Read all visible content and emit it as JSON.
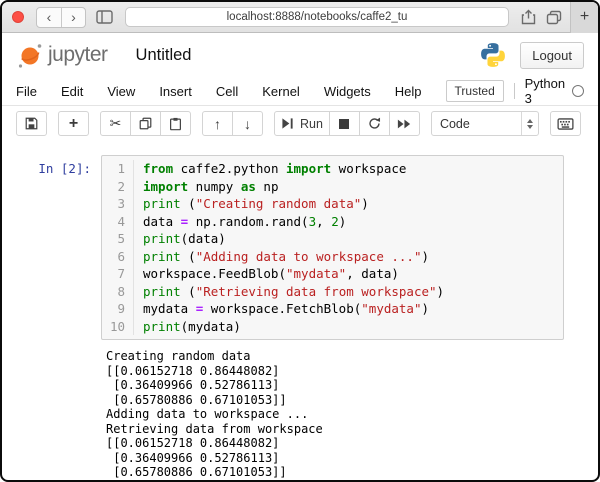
{
  "browser": {
    "url": "localhost:8888/notebooks/caffe2_tu",
    "back_label": "‹",
    "forward_label": "›",
    "new_tab_label": "+"
  },
  "header": {
    "brand": "jupyter",
    "title": "Untitled",
    "logout_label": "Logout"
  },
  "menu": {
    "items": [
      "File",
      "Edit",
      "View",
      "Insert",
      "Cell",
      "Kernel",
      "Widgets",
      "Help"
    ],
    "trusted_label": "Trusted",
    "kernel_name": "Python 3"
  },
  "toolbar": {
    "run_label": "Run",
    "cell_type_value": "Code",
    "icons": {
      "add": "+",
      "cut": "✂",
      "move_up": "↑",
      "move_down": "↓"
    }
  },
  "cell": {
    "prompt": "In [2]:",
    "lines": [
      {
        "n": 1,
        "tokens": [
          {
            "c": "kw",
            "t": "from"
          },
          {
            "c": "pl",
            "t": " caffe2.python "
          },
          {
            "c": "kw",
            "t": "import"
          },
          {
            "c": "pl",
            "t": " workspace"
          }
        ]
      },
      {
        "n": 2,
        "tokens": [
          {
            "c": "kw",
            "t": "import"
          },
          {
            "c": "pl",
            "t": " numpy "
          },
          {
            "c": "kw",
            "t": "as"
          },
          {
            "c": "pl",
            "t": " np"
          }
        ]
      },
      {
        "n": 3,
        "tokens": [
          {
            "c": "bi",
            "t": "print"
          },
          {
            "c": "pl",
            "t": " ("
          },
          {
            "c": "str",
            "t": "\"Creating random data\""
          },
          {
            "c": "pl",
            "t": ")"
          }
        ]
      },
      {
        "n": 4,
        "tokens": [
          {
            "c": "pl",
            "t": "data "
          },
          {
            "c": "op",
            "t": "="
          },
          {
            "c": "pl",
            "t": " np.random.rand("
          },
          {
            "c": "num",
            "t": "3"
          },
          {
            "c": "pl",
            "t": ", "
          },
          {
            "c": "num",
            "t": "2"
          },
          {
            "c": "pl",
            "t": ")"
          }
        ]
      },
      {
        "n": 5,
        "tokens": [
          {
            "c": "bi",
            "t": "print"
          },
          {
            "c": "pl",
            "t": "(data)"
          }
        ]
      },
      {
        "n": 6,
        "tokens": [
          {
            "c": "bi",
            "t": "print"
          },
          {
            "c": "pl",
            "t": " ("
          },
          {
            "c": "str",
            "t": "\"Adding data to workspace ...\""
          },
          {
            "c": "pl",
            "t": ")"
          }
        ]
      },
      {
        "n": 7,
        "tokens": [
          {
            "c": "pl",
            "t": "workspace.FeedBlob("
          },
          {
            "c": "str",
            "t": "\"mydata\""
          },
          {
            "c": "pl",
            "t": ", data)"
          }
        ]
      },
      {
        "n": 8,
        "tokens": [
          {
            "c": "bi",
            "t": "print"
          },
          {
            "c": "pl",
            "t": " ("
          },
          {
            "c": "str",
            "t": "\"Retrieving data from workspace\""
          },
          {
            "c": "pl",
            "t": ")"
          }
        ]
      },
      {
        "n": 9,
        "tokens": [
          {
            "c": "pl",
            "t": "mydata "
          },
          {
            "c": "op",
            "t": "="
          },
          {
            "c": "pl",
            "t": " workspace.FetchBlob("
          },
          {
            "c": "str",
            "t": "\"mydata\""
          },
          {
            "c": "pl",
            "t": ")"
          }
        ]
      },
      {
        "n": 10,
        "tokens": [
          {
            "c": "bi",
            "t": "print"
          },
          {
            "c": "pl",
            "t": "(mydata)"
          }
        ]
      }
    ]
  },
  "output": {
    "lines": [
      "Creating random data",
      "[[0.06152718 0.86448082]",
      " [0.36409966 0.52786113]",
      " [0.65780886 0.67101053]]",
      "Adding data to workspace ...",
      "Retrieving data from workspace",
      "[[0.06152718 0.86448082]",
      " [0.36409966 0.52786113]",
      " [0.65780886 0.67101053]]"
    ]
  },
  "colors": {
    "keyword": "#008000",
    "builtin": "#008000",
    "string": "#BA2121",
    "number": "#008000",
    "operator": "#AA22FF",
    "prompt": "#303F9F",
    "jupyter_orange": "#F37626",
    "python_blue": "#366F9F",
    "python_yellow": "#FFD43B"
  }
}
